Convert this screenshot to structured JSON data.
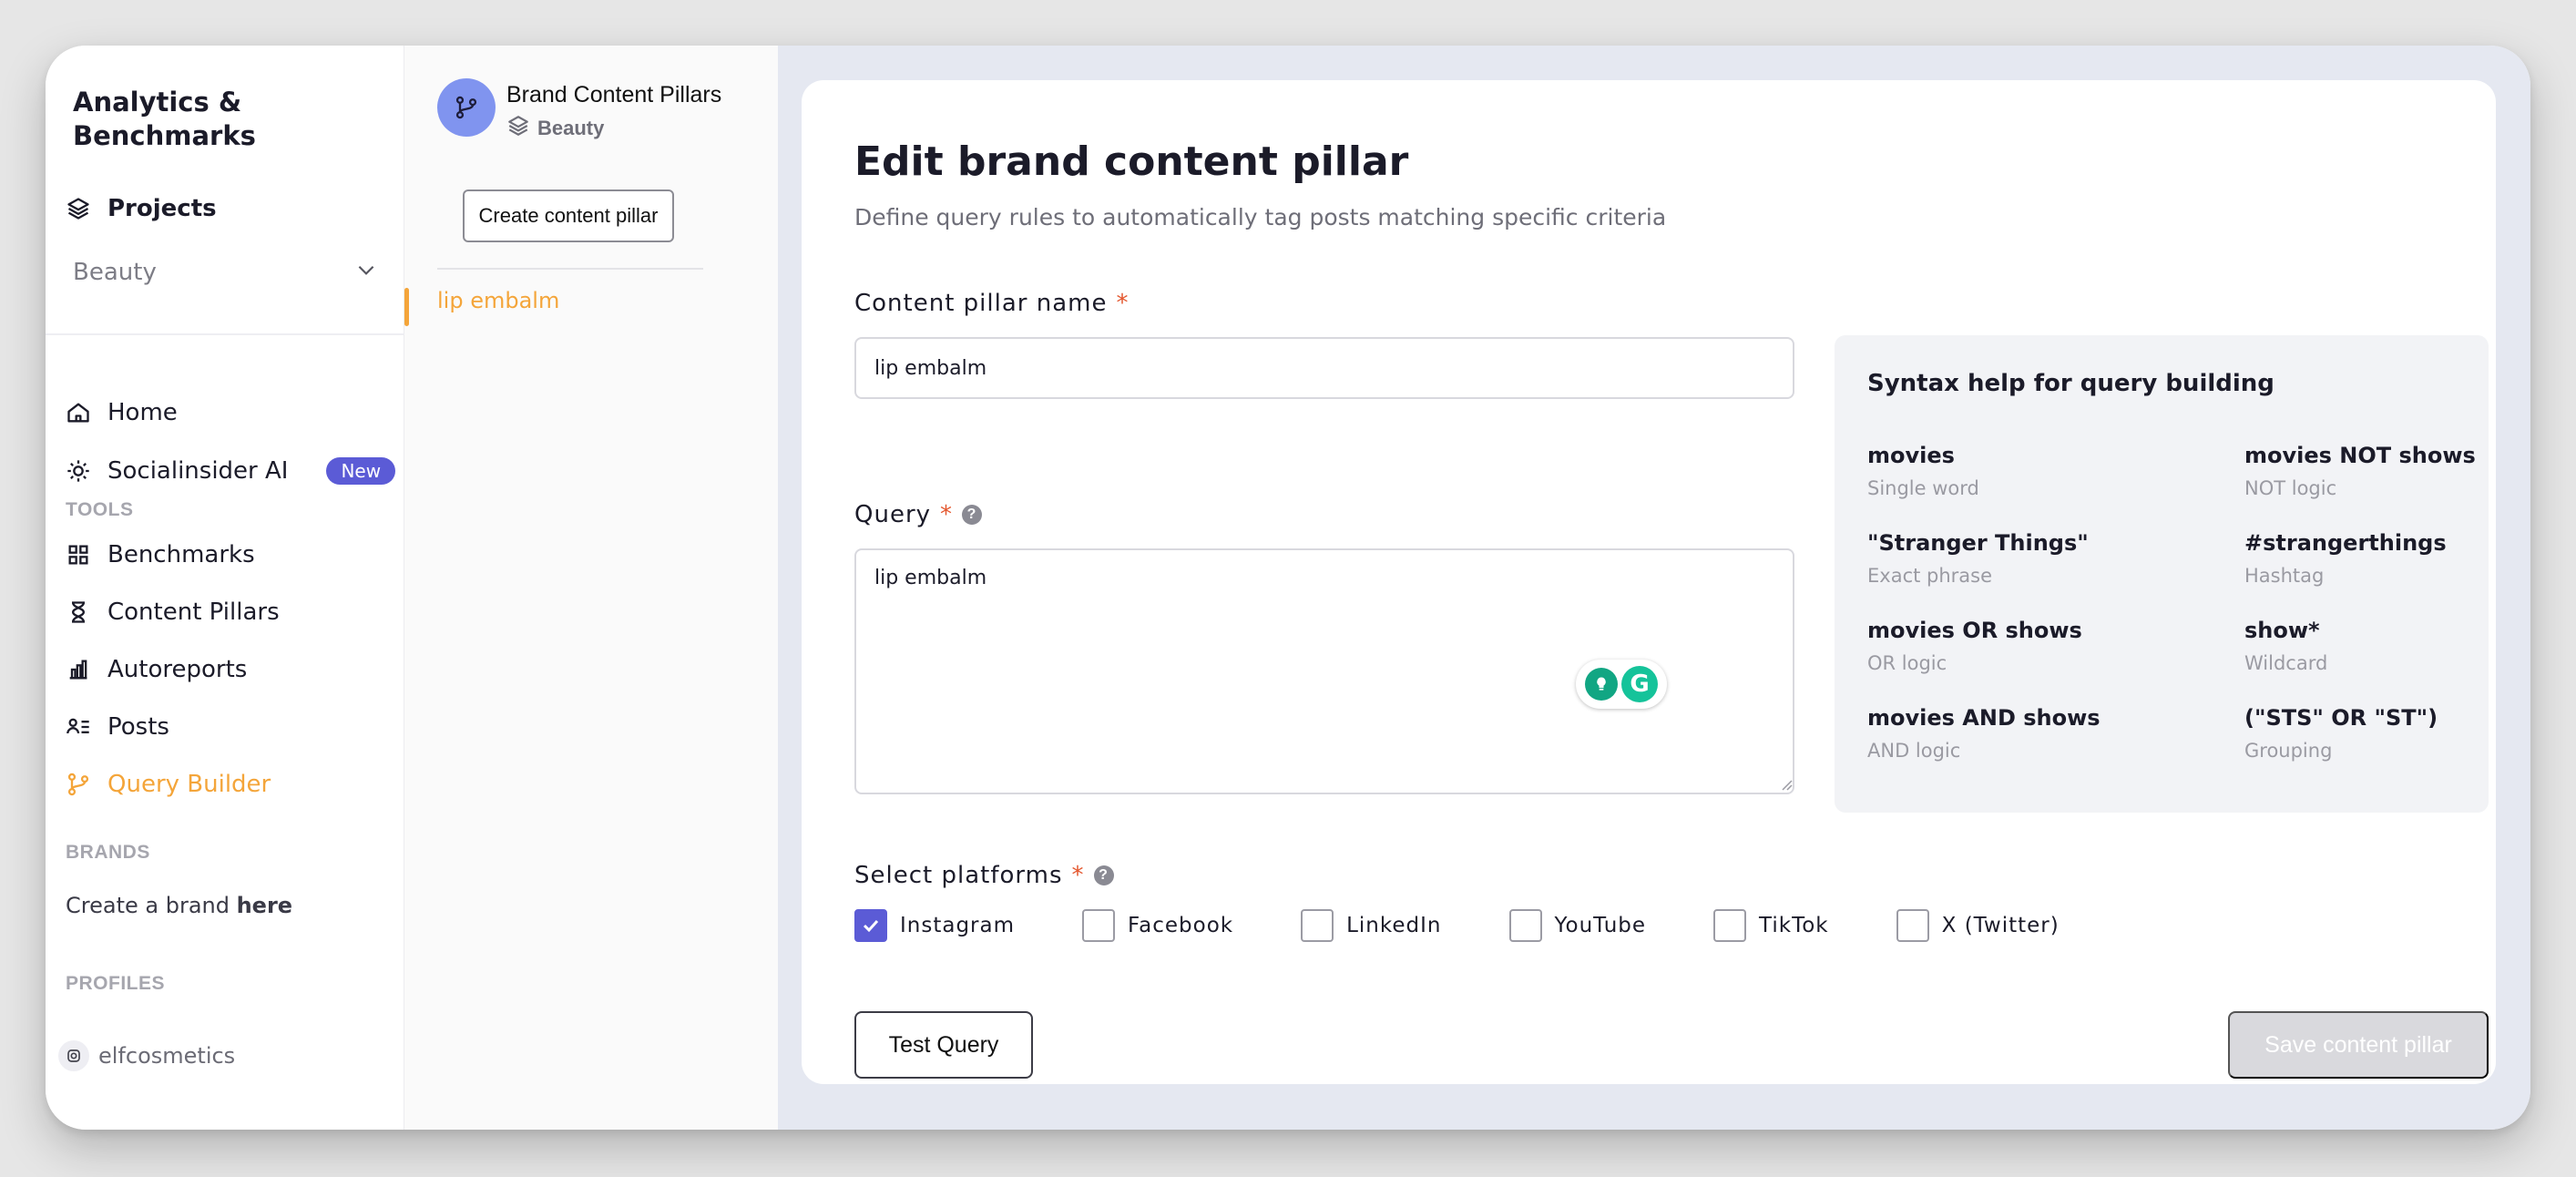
{
  "nav": {
    "title": "Analytics & Benchmarks",
    "projects_label": "Projects",
    "workspace": "Beauty",
    "items": [
      {
        "label": "Home",
        "icon": "home-icon"
      },
      {
        "label": "Socialinsider AI",
        "icon": "sparkle-icon",
        "badge": "New"
      }
    ],
    "tools_heading": "TOOLS",
    "tools": [
      {
        "label": "Benchmarks",
        "icon": "grid-icon"
      },
      {
        "label": "Content Pillars",
        "icon": "hourglass-icon"
      },
      {
        "label": "Autoreports",
        "icon": "bar-chart-icon"
      },
      {
        "label": "Posts",
        "icon": "list-user-icon"
      },
      {
        "label": "Query Builder",
        "icon": "branch-icon",
        "active": true
      }
    ],
    "brands_heading": "BRANDS",
    "create_brand_prefix": "Create a brand ",
    "create_brand_link": "here",
    "profiles_heading": "PROFILES",
    "profile": {
      "name": "elfcosmetics",
      "icon": "instagram-icon"
    }
  },
  "pillars": {
    "header_title": "Brand Content Pillars",
    "header_subtitle": "Beauty",
    "create_button": "Create content pillar",
    "items": [
      "lip embalm"
    ]
  },
  "form": {
    "title": "Edit brand content pillar",
    "subtitle": "Define query rules to automatically tag posts matching specific criteria",
    "name_label": "Content pillar name",
    "name_value": "lip embalm",
    "query_label": "Query",
    "query_value": "lip embalm",
    "required_mark": "*",
    "platforms_label": "Select platforms",
    "platforms": [
      {
        "label": "Instagram",
        "checked": true
      },
      {
        "label": "Facebook",
        "checked": false
      },
      {
        "label": "LinkedIn",
        "checked": false
      },
      {
        "label": "YouTube",
        "checked": false
      },
      {
        "label": "TikTok",
        "checked": false
      },
      {
        "label": "X (Twitter)",
        "checked": false
      }
    ],
    "test_button": "Test Query",
    "save_button": "Save content pillar"
  },
  "syntax_help": {
    "title": "Syntax help for query building",
    "items": [
      {
        "key": "movies",
        "desc": "Single word"
      },
      {
        "key": "movies NOT shows",
        "desc": "NOT logic"
      },
      {
        "key": "\"Stranger Things\"",
        "desc": "Exact phrase"
      },
      {
        "key": "#strangerthings",
        "desc": "Hashtag"
      },
      {
        "key": "movies OR shows",
        "desc": "OR logic"
      },
      {
        "key": "show*",
        "desc": "Wildcard"
      },
      {
        "key": "movies AND shows",
        "desc": "AND logic"
      },
      {
        "key": "(\"STS\" OR \"ST\")",
        "desc": "Grouping"
      }
    ]
  },
  "colors": {
    "accent": "#5b5bd6",
    "active_nav": "#f4a53a",
    "required": "#e4572e"
  }
}
